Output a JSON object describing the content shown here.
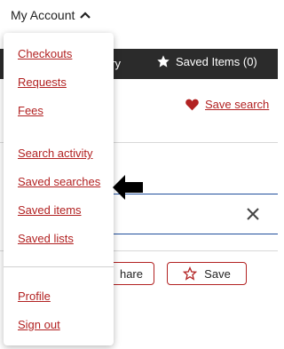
{
  "account": {
    "label": "My Account"
  },
  "toolbar": {
    "history_partial": "ory",
    "saved_items": "Saved Items (0)"
  },
  "search_actions": {
    "save_search": "Save search"
  },
  "result_card": {
    "share_partial": "hare",
    "save": "Save"
  },
  "menu": {
    "items": [
      {
        "label": "Checkouts"
      },
      {
        "label": "Requests"
      },
      {
        "label": "Fees"
      },
      {
        "label": "Search activity"
      },
      {
        "label": "Saved searches"
      },
      {
        "label": "Saved items"
      },
      {
        "label": "Saved lists"
      },
      {
        "label": "Profile"
      },
      {
        "label": "Sign out"
      }
    ]
  },
  "colors": {
    "link": "#b22222",
    "bar": "#2b2b2b",
    "focus": "#1f4e9c"
  },
  "icons": [
    "chevron-up-icon",
    "star-icon",
    "heart-icon",
    "close-icon",
    "star-outline-icon",
    "arrow-left-icon"
  ]
}
